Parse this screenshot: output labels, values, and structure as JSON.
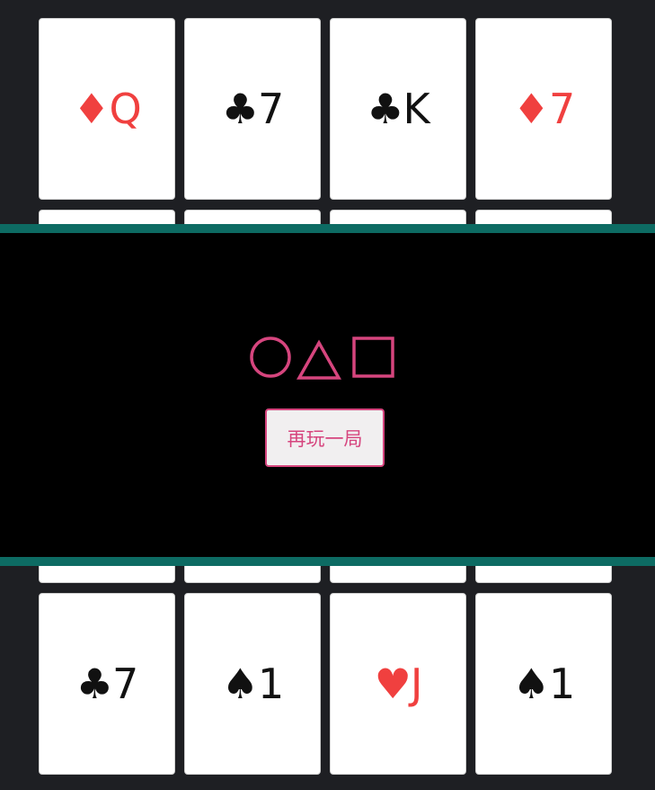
{
  "cards": [
    {
      "suit": "♦",
      "rank": "Q",
      "color": "red"
    },
    {
      "suit": "♣",
      "rank": "7",
      "color": "black"
    },
    {
      "suit": "♣",
      "rank": "K",
      "color": "black"
    },
    {
      "suit": "♦",
      "rank": "7",
      "color": "red"
    },
    {
      "suit": "",
      "rank": "",
      "color": "black"
    },
    {
      "suit": "",
      "rank": "",
      "color": "black"
    },
    {
      "suit": "",
      "rank": "",
      "color": "black"
    },
    {
      "suit": "",
      "rank": "",
      "color": "black"
    },
    {
      "suit": "",
      "rank": "",
      "color": "black"
    },
    {
      "suit": "",
      "rank": "",
      "color": "black"
    },
    {
      "suit": "",
      "rank": "",
      "color": "black"
    },
    {
      "suit": "",
      "rank": "",
      "color": "black"
    },
    {
      "suit": "♣",
      "rank": "7",
      "color": "black"
    },
    {
      "suit": "♠",
      "rank": "1",
      "color": "black"
    },
    {
      "suit": "♥",
      "rank": "J",
      "color": "red"
    },
    {
      "suit": "♠",
      "rank": "1",
      "color": "black"
    }
  ],
  "overlay": {
    "logo_icons": [
      "circle-icon",
      "triangle-icon",
      "square-icon"
    ],
    "replay_label": "再玩一局"
  },
  "colors": {
    "background": "#1e1f23",
    "overlay_border": "#0d6b63",
    "accent_pink": "#d6457e",
    "red_suit": "#f0403f",
    "black_suit": "#111111"
  }
}
